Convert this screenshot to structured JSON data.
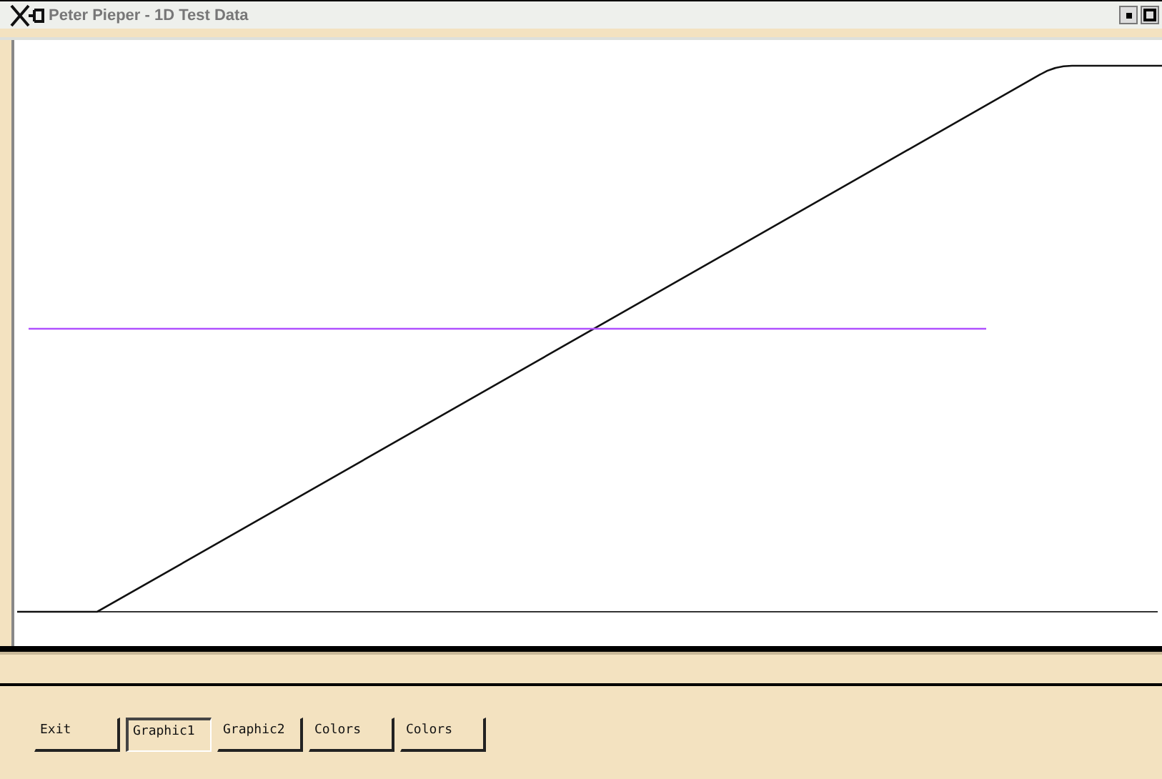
{
  "window": {
    "title": "Peter Pieper - 1D Test Data"
  },
  "buttons": [
    {
      "label": "Exit",
      "selected": false
    },
    {
      "label": "Graphic1",
      "selected": true
    },
    {
      "label": "Graphic2",
      "selected": false
    },
    {
      "label": "Colors",
      "selected": false
    },
    {
      "label": "Colors",
      "selected": false
    }
  ]
}
